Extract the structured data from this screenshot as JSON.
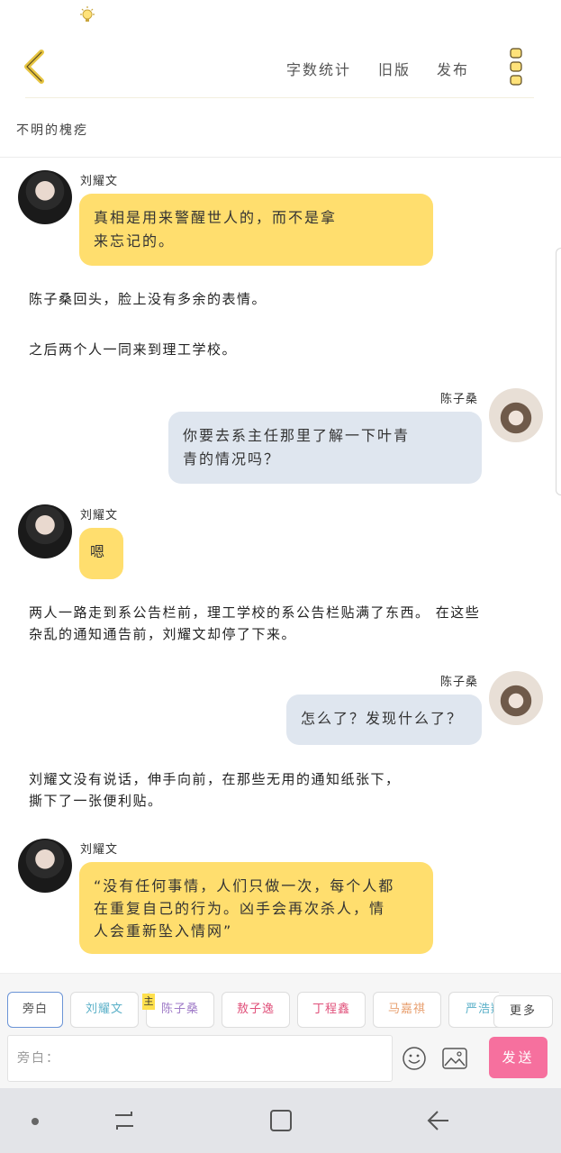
{
  "status": {
    "icon": "lightbulb-icon"
  },
  "toolbar": {
    "back_icon": "chevron-left-icon",
    "word_count": "字数统计",
    "old_version": "旧版",
    "publish": "发布",
    "more_icon": "vertical-dots-icon"
  },
  "story": {
    "title": "不明的槐疙"
  },
  "messages": [
    {
      "type": "char",
      "side": "left",
      "speaker": "刘耀文",
      "text_lines": [
        "真相是用来警醒世人的，而不是拿",
        "来忘记的。"
      ]
    },
    {
      "type": "narration",
      "text": "陈子桑回头，脸上没有多余的表情。"
    },
    {
      "type": "narration",
      "text": "之后两个人一同来到理工学校。"
    },
    {
      "type": "char",
      "side": "right",
      "speaker": "陈子桑",
      "text_lines": [
        "你要去系主任那里了解一下叶青",
        "青的情况吗？"
      ]
    },
    {
      "type": "char",
      "side": "left",
      "speaker": "刘耀文",
      "text_lines": [
        "嗯"
      ]
    },
    {
      "type": "narration",
      "text_lines": [
        "两人一路走到系公告栏前，理工学校的系公告栏贴满了东西。 在这些",
        "杂乱的通知通告前，刘耀文却停了下来。"
      ]
    },
    {
      "type": "char",
      "side": "right",
      "speaker": "陈子桑",
      "text_lines": [
        "怎么了？发现什么了？"
      ]
    },
    {
      "type": "narration",
      "text_lines": [
        "刘耀文没有说话，伸手向前，在那些无用的通知纸张下，",
        "撕下了一张便利贴。"
      ]
    },
    {
      "type": "char",
      "side": "left",
      "speaker": "刘耀文",
      "text_lines": [
        "“没有任何事情，人们只做一次，每个人都",
        "在重复自己的行为。凶手会再次杀人，情",
        "人会重新坠入情网”"
      ]
    }
  ],
  "characters": [
    {
      "label": "旁白",
      "color": "#555555",
      "active": true
    },
    {
      "label": "刘耀文",
      "color": "#5ab0c8"
    },
    {
      "label": "陈子桑",
      "color": "#a07cc8",
      "tag": "主"
    },
    {
      "label": "敖子逸",
      "color": "#e0507a"
    },
    {
      "label": "丁程鑫",
      "color": "#e0507a"
    },
    {
      "label": "马嘉祺",
      "color": "#e8a070"
    },
    {
      "label": "严浩翔",
      "color": "#5ab0c8"
    }
  ],
  "more_chars": "更多",
  "composer": {
    "placeholder": "旁白：",
    "emoji_icon": "smiley-icon",
    "image_icon": "image-icon",
    "send": "发送"
  },
  "navbar": {
    "recent_icon": "recent-apps-icon",
    "home_icon": "home-icon",
    "back_icon": "back-arrow-icon"
  },
  "colors": {
    "bubble_left": "#ffde6e",
    "bubble_right": "#dfe6ef",
    "send": "#f6709e",
    "active_chip": "#6b94d6"
  }
}
